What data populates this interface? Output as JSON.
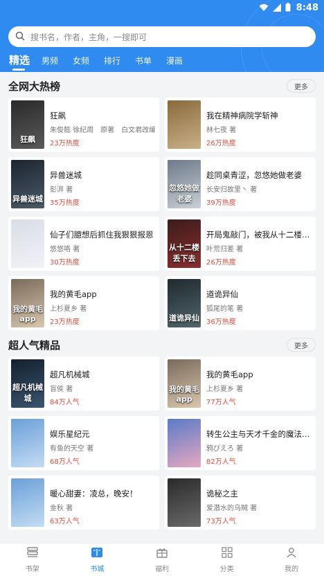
{
  "status": {
    "time": "8:48",
    "icons": [
      "wifi-icon",
      "signal-icon",
      "battery-icon"
    ]
  },
  "search": {
    "placeholder": "搜书名，作者，主角，一搜即可"
  },
  "tabs": [
    "精选",
    "男频",
    "女频",
    "排行",
    "书单",
    "漫画"
  ],
  "sections": [
    {
      "title": "全网大热榜",
      "more": "更多",
      "books": [
        {
          "title": "狂飙",
          "author": "朱俊懿 徐纪周　原著　白文君改编 著",
          "stat": "23万热度",
          "cover_text": "狂飙",
          "cover_colors": [
            "#2a2a2a",
            "#5a5a5a"
          ]
        },
        {
          "title": "我在精神病院学斩神",
          "author": "林七夜 著",
          "stat": "26万热度",
          "cover_text": "",
          "cover_colors": [
            "#8a6a3a",
            "#c9b089"
          ]
        },
        {
          "title": "异兽迷城",
          "author": "彭湃 著",
          "stat": "35万热度",
          "cover_text": "异兽迷城",
          "cover_colors": [
            "#1c2530",
            "#4b5a68"
          ]
        },
        {
          "title": "趁同桌青涩，忽悠她做老婆",
          "author": "长安归故里丶 著",
          "stat": "39万热度",
          "cover_text": "忽悠她做老婆",
          "cover_colors": [
            "#6d7a8a",
            "#c9cfd6"
          ]
        },
        {
          "title": "仙子们臆想后抓住我狠狠报恩",
          "author": "悠悠咯 著",
          "stat": "30万热度",
          "cover_text": "",
          "cover_colors": [
            "#d9dde6",
            "#f1f2f6"
          ]
        },
        {
          "title": "开局鬼敲门，被我从十二楼丢下去",
          "author": "叶荒归差 著",
          "stat": "26万热度",
          "cover_text": "从十二楼丢下去",
          "cover_colors": [
            "#3c1c1c",
            "#8a2e2e"
          ]
        },
        {
          "title": "我的黄毛app",
          "author": "上杉夏乡 著",
          "stat": "23万热度",
          "cover_text": "我的黄毛app",
          "cover_colors": [
            "#7a6a5a",
            "#d8c6ae"
          ]
        },
        {
          "title": "道诡异仙",
          "author": "狐尾的笔 著",
          "stat": "36万热度",
          "cover_text": "道诡异仙",
          "cover_colors": [
            "#1e2a2f",
            "#53656d"
          ]
        }
      ]
    },
    {
      "title": "超人气精品",
      "more": "更多",
      "books": [
        {
          "title": "超凡机械城",
          "author": "盲侯 著",
          "stat": "84万人气",
          "cover_text": "超凡机械城",
          "cover_colors": [
            "#14202e",
            "#3a5670"
          ]
        },
        {
          "title": "我的黄毛app",
          "author": "上杉夏乡 著",
          "stat": "77万人气",
          "cover_text": "我的黄毛app",
          "cover_colors": [
            "#7a6a5a",
            "#d8c6ae"
          ]
        },
        {
          "title": "娱乐星纪元",
          "author": "有鱼的天空 著",
          "stat": "68万人气",
          "cover_text": "",
          "cover_colors": [
            "#6aa0d8",
            "#c4dcf4"
          ]
        },
        {
          "title": "转生公主与天才千金的魔法革命",
          "author": "鸦ぴえろ 著",
          "stat": "82万人气",
          "cover_text": "",
          "cover_colors": [
            "#5a7ac8",
            "#e6a8c0"
          ]
        },
        {
          "title": "暖心甜妻：凌总，晚安！",
          "author": "金秋 著",
          "stat": "63万人气",
          "cover_text": "",
          "cover_colors": [
            "#6aa0d8",
            "#c4dcf4"
          ]
        },
        {
          "title": "诡秘之主",
          "author": "爱潜水的乌贼 著",
          "stat": "73万人气",
          "cover_text": "",
          "cover_colors": [
            "#2a2a2a",
            "#6a6a6a"
          ]
        }
      ]
    }
  ],
  "bottom_nav": [
    {
      "label": "书架",
      "icon": "bookshelf-icon"
    },
    {
      "label": "书城",
      "icon": "book-open-icon"
    },
    {
      "label": "福利",
      "icon": "gift-icon"
    },
    {
      "label": "分类",
      "icon": "grid-icon"
    },
    {
      "label": "我的",
      "icon": "user-icon"
    }
  ],
  "colors": {
    "primary": "#2f8bf0",
    "hot": "#e94b3c"
  }
}
